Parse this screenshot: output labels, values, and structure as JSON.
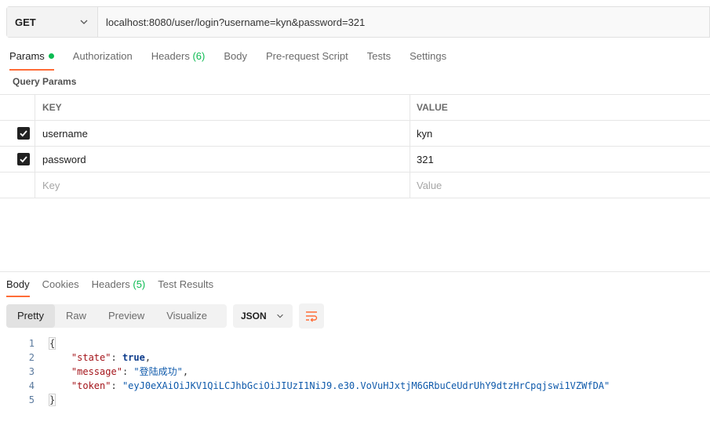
{
  "request": {
    "method": "GET",
    "url": "localhost:8080/user/login?username=kyn&password=321"
  },
  "request_tabs": [
    {
      "label": "Params",
      "active": true,
      "dot": true
    },
    {
      "label": "Authorization"
    },
    {
      "label": "Headers",
      "count": "(6)"
    },
    {
      "label": "Body"
    },
    {
      "label": "Pre-request Script"
    },
    {
      "label": "Tests"
    },
    {
      "label": "Settings"
    }
  ],
  "query_params": {
    "title": "Query Params",
    "headers": {
      "key": "KEY",
      "value": "VALUE"
    },
    "rows": [
      {
        "key": "username",
        "value": "kyn",
        "checked": true
      },
      {
        "key": "password",
        "value": "321",
        "checked": true
      }
    ],
    "placeholder": {
      "key": "Key",
      "value": "Value"
    }
  },
  "response_tabs": [
    {
      "label": "Body",
      "active": true
    },
    {
      "label": "Cookies"
    },
    {
      "label": "Headers",
      "count": "(5)"
    },
    {
      "label": "Test Results"
    }
  ],
  "view_modes": [
    "Pretty",
    "Raw",
    "Preview",
    "Visualize"
  ],
  "active_view_mode": "Pretty",
  "format": "JSON",
  "code": {
    "line_numbers": [
      "1",
      "2",
      "3",
      "4",
      "5"
    ],
    "open_brace": "{",
    "close_brace": "}",
    "fields": [
      {
        "key": "\"state\"",
        "value": "true",
        "kind": "boolean",
        "comma": ","
      },
      {
        "key": "\"message\"",
        "value": "\"登陆成功\"",
        "kind": "string",
        "comma": ","
      },
      {
        "key": "\"token\"",
        "value": "\"eyJ0eXAiOiJKV1QiLCJhbGciOiJIUzI1NiJ9.e30.VoVuHJxtjM6GRbuCeUdrUhY9dtzHrCpqjswi1VZWfDA\"",
        "kind": "string",
        "comma": ""
      }
    ]
  },
  "colors": {
    "accent": "#ff6c37",
    "count_green": "#0cbb52",
    "json_key": "#a4151b",
    "json_string": "#0f5aab"
  }
}
